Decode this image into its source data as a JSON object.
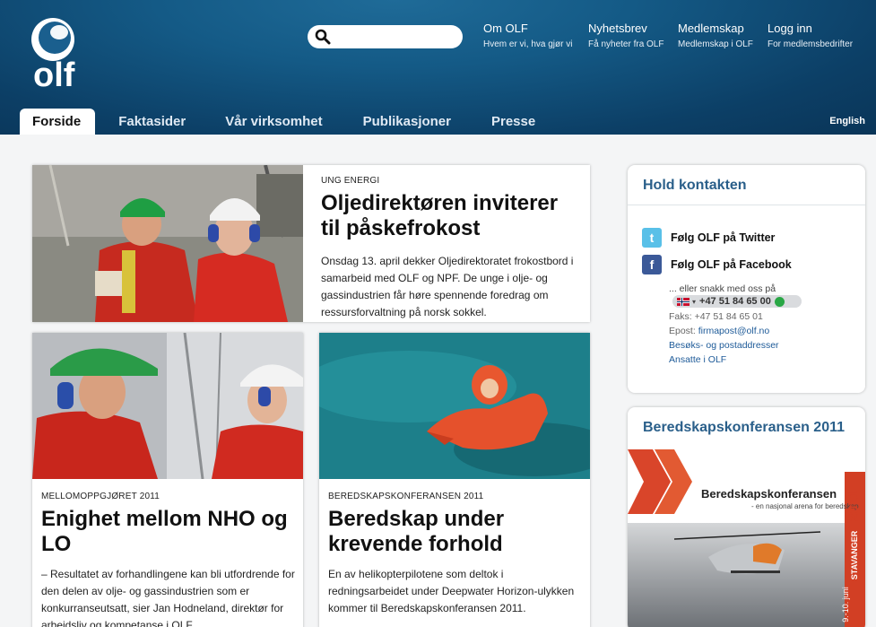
{
  "header": {
    "logo_text": "olf",
    "search": {
      "placeholder": "",
      "value": ""
    },
    "top_links": [
      {
        "title": "Om OLF",
        "subtitle": "Hvem er vi, hva gjør vi"
      },
      {
        "title": "Nyhetsbrev",
        "subtitle": "Få nyheter fra OLF"
      },
      {
        "title": "Medlemskap",
        "subtitle": "Medlemskap i OLF"
      },
      {
        "title": "Logg inn",
        "subtitle": "For medlemsbedrifter"
      }
    ],
    "main_nav": [
      "Forside",
      "Faktasider",
      "Vår virksomhet",
      "Publikasjoner",
      "Presse"
    ],
    "language_link": "English"
  },
  "articles": [
    {
      "kicker": "UNG ENERGI",
      "title": "Oljedirektøren inviterer til påskefrokost",
      "body": "Onsdag 13. april dekker Oljedirektoratet frokostbord i samarbeid med OLF og NPF. De unge i olje- og gassindustrien får høre spennende foredrag om ressursforvaltning på norsk sokkel.",
      "image": "offshore-workers-helmets"
    },
    {
      "kicker": "MELLOMOPPGJØRET 2011",
      "title": "Enighet mellom NHO og LO",
      "body": "– Resultatet av forhandlingene kan bli utfordrende for den delen av olje- og gassindustrien som er konkurranseutsatt, sier Jan Hodneland, direktør for arbeidsliv og kompetanse i OLF.",
      "image": "offshore-workers-headsets"
    },
    {
      "kicker": "BEREDSKAPSKONFERANSEN 2011",
      "title": "Beredskap under krevende forhold",
      "body": "En av helikopterpilotene som deltok i redningsarbeidet under Deepwater Horizon-ulykken kommer til Beredskapskonferansen 2011.",
      "image": "survival-suit-in-water"
    }
  ],
  "sidebar": {
    "contact": {
      "title": "Hold kontakten",
      "twitter": "Følg OLF på Twitter",
      "facebook": "Følg OLF på Facebook",
      "chat_intro": "... eller snakk med oss på",
      "phone": "+47 51 84 65 00",
      "fax": "Faks: +47 51 84 65 01",
      "email_label": "Epost:",
      "email": "firmapost@olf.no",
      "address_link": "Besøks- og postaddresser",
      "staff_link": "Ansatte i OLF"
    },
    "conference": {
      "title": "Beredskapskonferansen 2011",
      "banner_title": "Beredskapskonferansen",
      "banner_sub": "- en nasjonal arena for beredskap",
      "year": "2011",
      "city": "STAVANGER",
      "dates": "9.-10. juni"
    }
  },
  "colors": {
    "header_dark": "#0c3f66",
    "header_light": "#1f6b98",
    "accent_blue": "#2a5f8a",
    "link": "#1d5a98"
  }
}
